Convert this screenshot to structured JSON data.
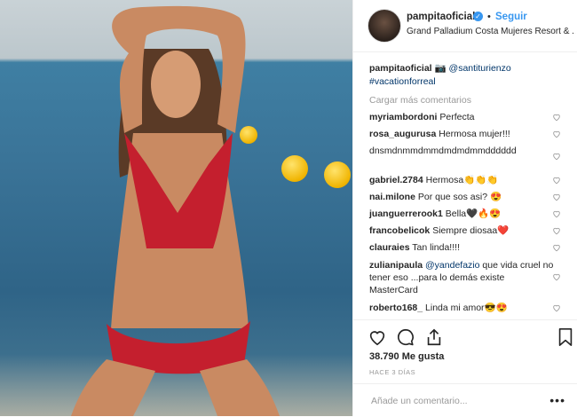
{
  "post": {
    "username": "pampitaoficial",
    "follow_label": "Seguir",
    "separator": "•",
    "location": "Grand Palladium Costa Mujeres Resort & ...",
    "caption": {
      "author": "pampitaoficial",
      "camera_emoji": "📷",
      "mention": "@santiturienzo",
      "hashtag": "#vacationforreal"
    },
    "load_more_label": "Cargar más comentarios",
    "comments": [
      {
        "user": "myriambordoni",
        "text": "Perfecta"
      },
      {
        "user": "rosa_augurusa",
        "text": "Hermosa mujer!!!"
      },
      {
        "user": "",
        "text": "dnsmdnmmdmmdmdmdmmdddddd"
      },
      {
        "user": "gabriel.2784",
        "text": "Hermosa👏👏👏"
      },
      {
        "user": "nai.milone",
        "text": "Por que sos asi? 😍"
      },
      {
        "user": "juanguerrerook1",
        "text": "Bella🖤🔥😍"
      },
      {
        "user": "francobelicok",
        "text": "Siempre diosaa❤️"
      },
      {
        "user": "clauraies",
        "text": "Tan linda!!!!"
      },
      {
        "user": "zulianipaula",
        "mention": "@yandefazio",
        "text": "que vida cruel no tener eso ...para lo demás existe MasterCard"
      },
      {
        "user": "roberto168_",
        "text": "Linda mi amor😎😍"
      }
    ],
    "likes_text": "38.790 Me gusta",
    "time_ago": "HACE 3 DÍAS",
    "comment_placeholder": "Añade un comentario...",
    "more_label": "•••"
  },
  "icons": {
    "like": "heart-icon",
    "comment": "comment-icon",
    "share": "share-icon",
    "save": "bookmark-icon",
    "verified": "verified-badge-icon"
  },
  "colors": {
    "accent": "#3897f0",
    "link": "#003569",
    "muted": "#999999",
    "text": "#262626",
    "border": "#efefef"
  }
}
